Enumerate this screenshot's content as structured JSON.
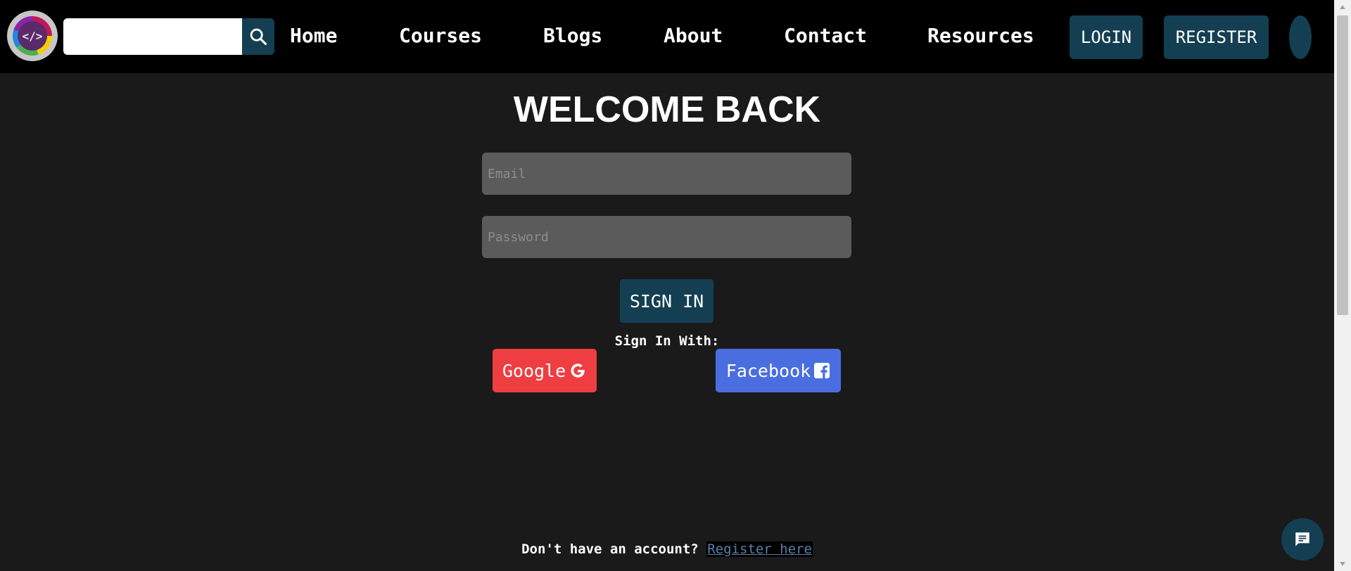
{
  "nav": {
    "search": {
      "value": "",
      "placeholder": ""
    },
    "links": {
      "home": "Home",
      "courses": "Courses",
      "blogs": "Blogs",
      "about": "About",
      "contact": "Contact",
      "resources": "Resources"
    },
    "login_label": "LOGIN",
    "register_label": "REGISTER",
    "logo_icon": "code-brackets-icon"
  },
  "main": {
    "title": "WELCOME BACK",
    "email_placeholder": "Email",
    "password_placeholder": "Password",
    "signin_label": "SIGN IN",
    "signin_with": "Sign In With:",
    "google_label": "Google",
    "facebook_label": "Facebook",
    "footer_prompt": "Don't have an account? ",
    "footer_link": "Register here"
  },
  "colors": {
    "navbar_bg": "#000000",
    "page_bg": "#1a1a1a",
    "accent": "#143f52",
    "google": "#ef3e42",
    "facebook": "#4a6ee0",
    "input_bg": "#5b5b5b"
  }
}
